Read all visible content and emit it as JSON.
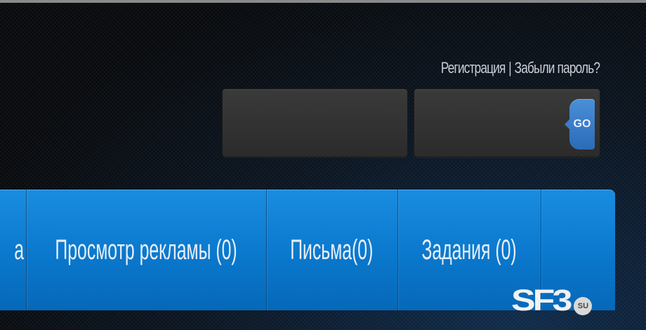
{
  "auth": {
    "register_label": "Регистрация",
    "separator": "|",
    "forgot_label": "Забыли пароль?"
  },
  "login_form": {
    "login_value": "",
    "password_value": "",
    "go_label": "GO"
  },
  "nav": {
    "items": [
      {
        "label": "а"
      },
      {
        "label": "Просмотр рекламы (0)"
      },
      {
        "label": "Письма(0)"
      },
      {
        "label": "Задания (0)"
      },
      {
        "label": ""
      }
    ]
  },
  "watermark": {
    "logo_text": "SF3",
    "badge_text": "SU"
  },
  "colors": {
    "nav_blue": "#0a78cc",
    "go_blue": "#2c6bb8",
    "field_bg": "#2f2f2f"
  }
}
